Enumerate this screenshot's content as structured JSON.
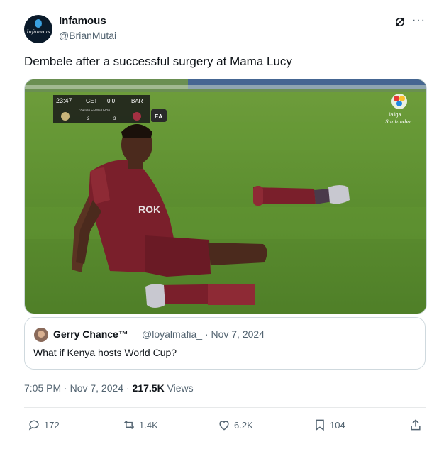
{
  "author": {
    "name": "Infamous",
    "handle": "@BrianMutai",
    "avatar_text": "Infamous"
  },
  "tweet": {
    "text": "Dembele after a successful surgery at Mama Lucy"
  },
  "media": {
    "scoreboard": {
      "time": "23:47",
      "home": "GET",
      "score": "0 0",
      "away": "BAR",
      "sub": "FALTAS COMETIDAS",
      "fouls_home": "2",
      "fouls_away": "3",
      "ea_badge": "EA"
    },
    "league_logo": {
      "line1": "laliga",
      "line2": "Santander"
    },
    "shirt_sponsor": "ROK"
  },
  "quote": {
    "name": "Gerry Chance™",
    "handle": "@loyalmafia_ · Nov 7, 2024",
    "text": "What if Kenya hosts World Cup?"
  },
  "meta": {
    "time_date": "7:05 PM · Nov 7, 2024 · ",
    "views_count": "217.5K",
    "views_label": " Views"
  },
  "actions": {
    "replies": "172",
    "reposts": "1.4K",
    "likes": "6.2K",
    "bookmarks": "104"
  },
  "icons": [
    "grok-icon",
    "more-icon",
    "reply-icon",
    "repost-icon",
    "like-icon",
    "bookmark-icon",
    "share-icon"
  ],
  "colors": {
    "text": "#0f1419",
    "secondary": "#536471",
    "border": "#cfd9de",
    "grass": "#5b8c2e",
    "kit": "#7a1f2b"
  }
}
